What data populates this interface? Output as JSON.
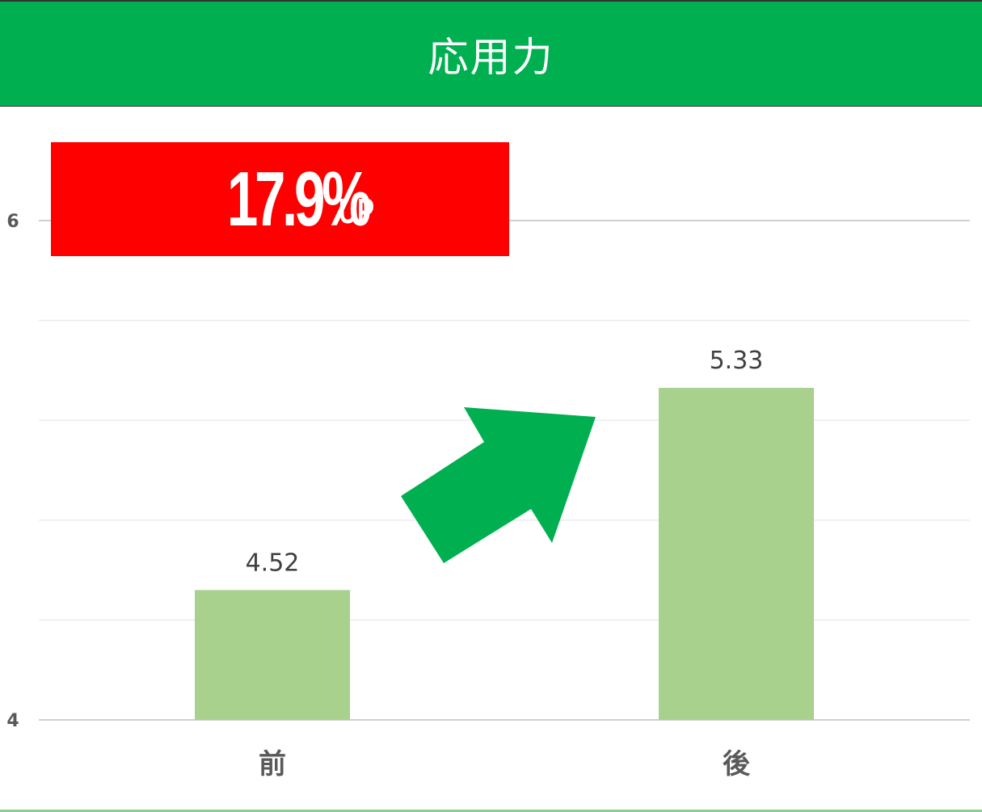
{
  "header": {
    "title": "応用力",
    "bg_color": "#00b050"
  },
  "badge": {
    "value": "17.9%",
    "suffix": "UP",
    "bg_color": "#ff0000"
  },
  "arrow": {
    "icon": "up-right-arrow-icon",
    "color": "#00b050"
  },
  "chart_data": {
    "type": "bar",
    "categories": [
      "前",
      "後"
    ],
    "values": [
      4.52,
      5.33
    ],
    "data_labels": [
      "4.52",
      "5.33"
    ],
    "ylim": [
      4,
      6
    ],
    "yticks": [
      4,
      6
    ],
    "ytick_labels": [
      "4",
      "6"
    ],
    "gridlines": [
      4,
      4.4,
      4.8,
      5.2,
      5.6,
      6
    ],
    "bar_color": "#a9d18e",
    "grid": true,
    "title": "応用力"
  }
}
